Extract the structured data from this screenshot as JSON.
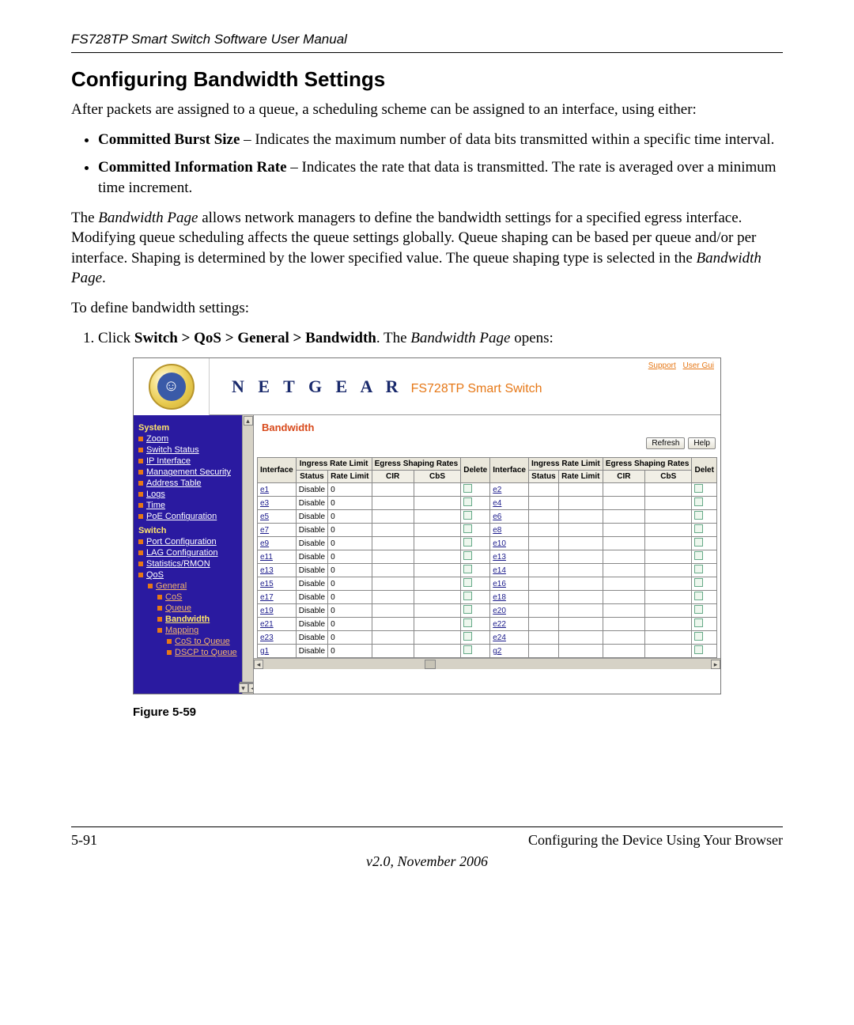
{
  "running_head": "FS728TP Smart Switch Software User Manual",
  "section_title": "Configuring Bandwidth Settings",
  "intro": "After packets are assigned to a queue, a scheduling scheme can be assigned to an interface, using either:",
  "bullets": [
    {
      "term": "Committed Burst Size",
      "desc": " – Indicates the maximum number of data bits transmitted within a specific time interval."
    },
    {
      "term": "Committed Information Rate",
      "desc": " – Indicates the rate that data is transmitted. The rate is averaged over a minimum time increment."
    }
  ],
  "para2_pre": "The ",
  "para2_em1": "Bandwidth Page",
  "para2_mid": " allows network managers to define the bandwidth settings for a specified egress interface. Modifying queue scheduling affects the queue settings globally. Queue shaping can be based per queue and/or per interface. Shaping is determined by the lower specified value. The queue shaping type is selected in the ",
  "para2_em2": "Bandwidth Page",
  "para2_post": ".",
  "para3": "To define bandwidth settings:",
  "step1_pre": "Click ",
  "step1_bold": "Switch > QoS > General > Bandwidth",
  "step1_mid": ". The ",
  "step1_em": "Bandwidth Page",
  "step1_post": " opens:",
  "figure_caption": "Figure 5-59",
  "footer_left": "5-91",
  "footer_right": "Configuring the Device Using Your Browser",
  "footer_version": "v2.0, November 2006",
  "shot": {
    "brand": "N E T G E A R",
    "product": "FS728TP Smart Switch",
    "top_links": [
      "Support",
      "User Gui"
    ],
    "sidebar": {
      "heads": [
        "System",
        "Switch"
      ],
      "system_links": [
        "Zoom",
        "Switch Status",
        "IP Interface",
        "Management Security",
        "Address Table",
        "Logs",
        "Time",
        "PoE Configuration"
      ],
      "switch_links": [
        "Port Configuration",
        "LAG Configuration",
        "Statistics/RMON",
        "QoS"
      ],
      "qos_sub": [
        "General"
      ],
      "general_sub": [
        "CoS",
        "Queue",
        "Bandwidth",
        "Mapping"
      ],
      "mapping_sub": [
        "CoS to Queue",
        "DSCP to Queue"
      ]
    },
    "main": {
      "title": "Bandwidth",
      "buttons": [
        "Refresh",
        "Help"
      ],
      "headers_top": [
        "Interface",
        "Ingress Rate Limit",
        "Egress Shaping Rates",
        "Delete",
        "Interface",
        "Ingress Rate Limit",
        "Egress Shaping Rates",
        "Delet"
      ],
      "headers_sub": [
        "Status",
        "Rate Limit",
        "CIR",
        "CbS",
        "Status",
        "Rate Limit",
        "CIR",
        "CbS"
      ],
      "rows": [
        {
          "l": {
            "if": "e1",
            "status": "Disable",
            "rate": "0"
          },
          "r": {
            "if": "e2"
          }
        },
        {
          "l": {
            "if": "e3",
            "status": "Disable",
            "rate": "0"
          },
          "r": {
            "if": "e4"
          }
        },
        {
          "l": {
            "if": "e5",
            "status": "Disable",
            "rate": "0"
          },
          "r": {
            "if": "e6"
          }
        },
        {
          "l": {
            "if": "e7",
            "status": "Disable",
            "rate": "0"
          },
          "r": {
            "if": "e8"
          }
        },
        {
          "l": {
            "if": "e9",
            "status": "Disable",
            "rate": "0"
          },
          "r": {
            "if": "e10"
          }
        },
        {
          "l": {
            "if": "e11",
            "status": "Disable",
            "rate": "0"
          },
          "r": {
            "if": "e13"
          }
        },
        {
          "l": {
            "if": "e13",
            "status": "Disable",
            "rate": "0"
          },
          "r": {
            "if": "e14"
          }
        },
        {
          "l": {
            "if": "e15",
            "status": "Disable",
            "rate": "0"
          },
          "r": {
            "if": "e16"
          }
        },
        {
          "l": {
            "if": "e17",
            "status": "Disable",
            "rate": "0"
          },
          "r": {
            "if": "e18"
          }
        },
        {
          "l": {
            "if": "e19",
            "status": "Disable",
            "rate": "0"
          },
          "r": {
            "if": "e20"
          }
        },
        {
          "l": {
            "if": "e21",
            "status": "Disable",
            "rate": "0"
          },
          "r": {
            "if": "e22"
          }
        },
        {
          "l": {
            "if": "e23",
            "status": "Disable",
            "rate": "0"
          },
          "r": {
            "if": "e24"
          }
        },
        {
          "l": {
            "if": "g1",
            "status": "Disable",
            "rate": "0"
          },
          "r": {
            "if": "g2"
          }
        }
      ]
    }
  }
}
